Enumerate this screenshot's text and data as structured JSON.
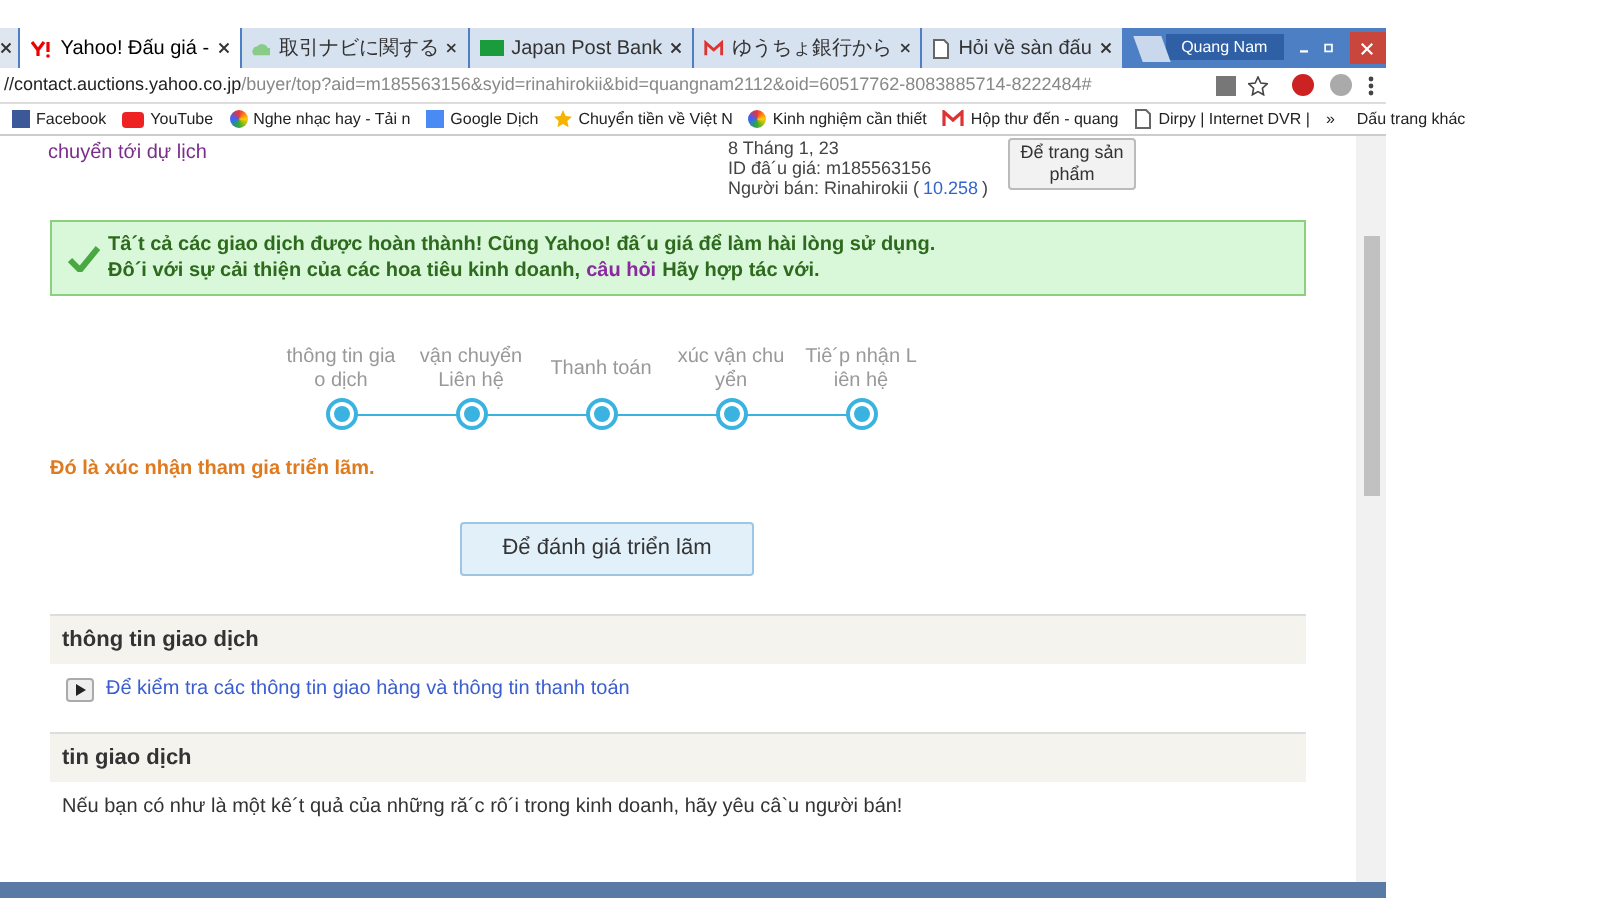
{
  "tabs": [
    {
      "label": "Yahoo! Đấu giá -",
      "selected": true
    },
    {
      "label": "取引ナビに関する",
      "selected": false
    },
    {
      "label": "Japan Post Bank",
      "selected": false
    },
    {
      "label": "ゆうちょ銀行から",
      "selected": false
    },
    {
      "label": "Hỏi về sàn đấu",
      "selected": false
    }
  ],
  "profile": "Quang Nam",
  "url": {
    "host": "//contact.auctions.yahoo.co.jp",
    "path": "/buyer/top?aid=m185563156&syid=rinahirokii&bid=quangnam2112&oid=60517762-8083885714-8222484#"
  },
  "bookmarks": [
    {
      "label": "Facebook"
    },
    {
      "label": "YouTube"
    },
    {
      "label": "Nghe nhạc hay - Tải n"
    },
    {
      "label": "Google Dịch"
    },
    {
      "label": "Chuyển tiền về Việt N"
    },
    {
      "label": "Kinh nghiệm cần thiết"
    },
    {
      "label": "Hộp thư đến - quang"
    },
    {
      "label": "Dirpy | Internet DVR |"
    }
  ],
  "bookmarks_more": "»",
  "bookmarks_other": "Dấu trang khác",
  "item": {
    "link": "chuyển tới dự lịch",
    "date": "8 Tháng 1, 23",
    "id_label": "ID đâ´u giá: m185563156",
    "seller_label": "Người bán: Rinahirokii (",
    "seller_score": "10.258",
    "seller_close": ")",
    "button": "Để trang sản phẩm"
  },
  "notice": {
    "line1": "Tâ´t cả các giao dịch được hoàn thành! Cũng Yahoo! đâ´u giá để làm hài lòng sử dụng.",
    "line2_before": "Đô´i với sự cải thiện của các hoa tiêu kinh doanh,",
    "line2_link": "câu hỏi",
    "line2_after": "Hãy hợp tác với."
  },
  "steps": [
    {
      "label": "thông tin gia o dịch",
      "done": true
    },
    {
      "label": "vận chuyển Liên hệ",
      "done": true
    },
    {
      "label": "Thanh toán",
      "done": true
    },
    {
      "label": "xúc vận chu yển",
      "done": true
    },
    {
      "label": "Tiê´p nhận L iên hệ",
      "done": true
    }
  ],
  "status_message": "Đó là xúc nhận tham gia triển lãm.",
  "rate_button": "Để đánh giá triển lãm",
  "sections": [
    {
      "title": "thông tin giao dịch",
      "link": "Để kiểm tra các thông tin giao hàng và thông tin thanh toán"
    },
    {
      "title": "tin giao dịch",
      "text": "Nếu bạn có như là một kê´t quả của những ră´c rô´i trong kinh doanh, hãy yêu câ`u người bán!"
    }
  ]
}
